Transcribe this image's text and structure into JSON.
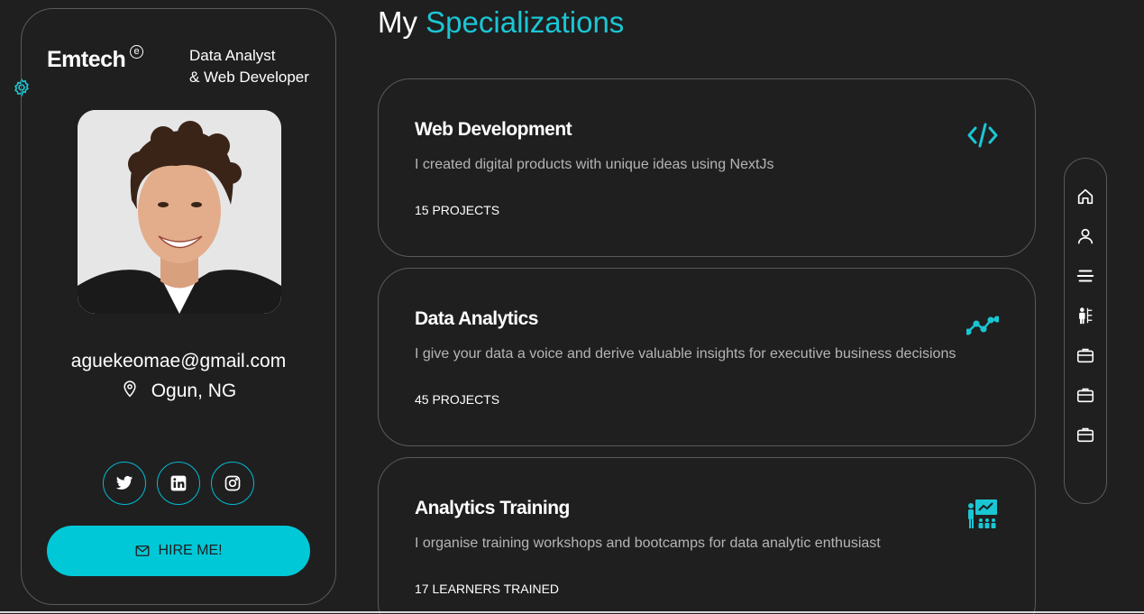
{
  "profile": {
    "brand": "Emtech",
    "brand_mark": "e",
    "role_line1": "Data Analyst",
    "role_line2": "& Web Developer",
    "email": "aguekeomae@gmail.com",
    "location": "Ogun, NG",
    "hire_label": "HIRE ME!"
  },
  "heading": {
    "prefix": "My",
    "accent": "Specializations"
  },
  "services": [
    {
      "title": "Web Development",
      "description": "I created digital products with unique ideas using NextJs",
      "meta": "15 PROJECTS",
      "icon": "code-icon"
    },
    {
      "title": "Data Analytics",
      "description": "I give your data a voice and derive valuable insights for executive business decisions",
      "meta": "45 PROJECTS",
      "icon": "analytics-line-icon"
    },
    {
      "title": "Analytics Training",
      "description": "I organise training workshops and bootcamps for data analytic enthusiast",
      "meta": "17 LEARNERS TRAINED",
      "icon": "presentation-icon"
    }
  ],
  "nav_icons": [
    "home-icon",
    "user-icon",
    "menu-icon",
    "resume-icon",
    "briefcase-icon",
    "briefcase-icon",
    "briefcase-icon"
  ],
  "colors": {
    "background": "#1f1f1f",
    "accent": "#00c8d7",
    "border": "#5a5a5a"
  }
}
